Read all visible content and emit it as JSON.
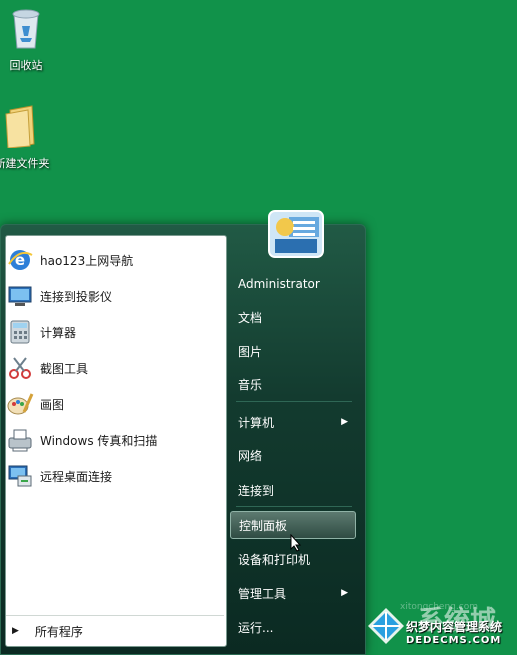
{
  "desktop": {
    "icons": [
      {
        "label": "回收站",
        "icon": "recycle-bin-icon"
      },
      {
        "label": "新建文件夹",
        "icon": "folder-icon"
      }
    ]
  },
  "start_menu": {
    "programs": [
      {
        "label": "hao123上网导航",
        "icon": "internet-explorer-icon"
      },
      {
        "label": "连接到投影仪",
        "icon": "projector-icon"
      },
      {
        "label": "计算器",
        "icon": "calculator-icon"
      },
      {
        "label": "截图工具",
        "icon": "snipping-tool-icon"
      },
      {
        "label": "画图",
        "icon": "paint-icon"
      },
      {
        "label": "Windows 传真和扫描",
        "icon": "fax-scan-icon"
      },
      {
        "label": "远程桌面连接",
        "icon": "remote-desktop-icon"
      }
    ],
    "all_programs": "所有程序",
    "right_items": [
      {
        "label": "Administrator"
      },
      {
        "label": "文档"
      },
      {
        "label": "图片"
      },
      {
        "label": "音乐"
      },
      {
        "label": "计算机",
        "submenu": true
      },
      {
        "label": "网络"
      },
      {
        "label": "连接到"
      },
      {
        "label": "控制面板",
        "highlighted": true
      },
      {
        "label": "设备和打印机"
      },
      {
        "label": "管理工具",
        "submenu": true
      },
      {
        "label": "运行..."
      }
    ]
  },
  "watermark": {
    "brand": "系统城",
    "line1": "织梦内容管理系统",
    "line2": "DEDECMS.COM",
    "faint": "xitongcheng.com"
  },
  "colors": {
    "desktop": "#11924a",
    "menu_dark": "#133b2f",
    "highlight": "#5d7a70"
  }
}
